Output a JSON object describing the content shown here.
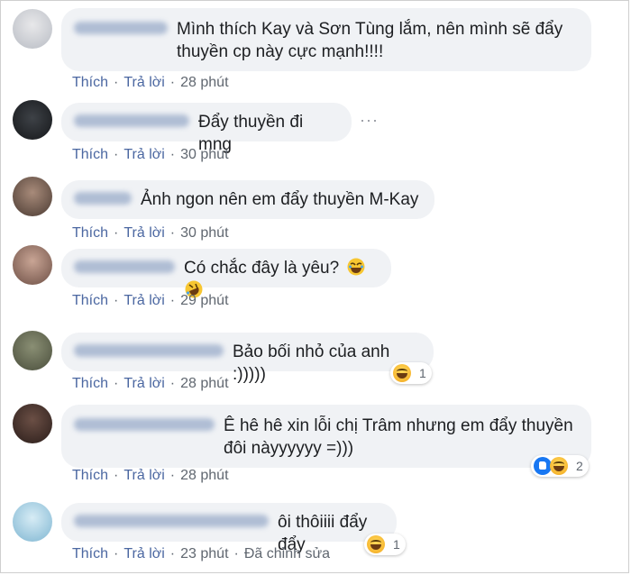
{
  "comments": [
    {
      "text": "Mình thích Kay và Sơn Tùng lắm, nên mình sẽ đẩy thuyền cp này cực mạnh!!!!",
      "actions": {
        "like": "Thích",
        "reply": "Trả lời",
        "time": "28 phút"
      }
    },
    {
      "text": "Đẩy thuyền đi mng",
      "more_icon": "···",
      "actions": {
        "like": "Thích",
        "reply": "Trả lời",
        "time": "30 phút"
      }
    },
    {
      "text": "Ảnh ngon nên em đẩy thuyền M-Kay",
      "actions": {
        "like": "Thích",
        "reply": "Trả lời",
        "time": "30 phút"
      }
    },
    {
      "text": "Có chắc đây là yêu?",
      "actions": {
        "like": "Thích",
        "reply": "Trả lời",
        "time": "29 phút"
      }
    },
    {
      "text": "Bảo bối nhỏ của anh :)))))",
      "reaction_count": "1",
      "actions": {
        "like": "Thích",
        "reply": "Trả lời",
        "time": "28 phút"
      }
    },
    {
      "text": "Ê hê hê xin lỗi chị Trâm nhưng em đẩy thuyền đôi nàyyyyyy =)))",
      "reaction_count": "2",
      "actions": {
        "like": "Thích",
        "reply": "Trả lời",
        "time": "28 phút"
      }
    },
    {
      "text": "ôi thôiiii đẩy đẩy",
      "reaction_count": "1",
      "actions": {
        "like": "Thích",
        "reply": "Trả lời",
        "time": "23 phút",
        "edited": "Đã chỉnh sửa"
      }
    }
  ],
  "colors": {
    "bubble": "#f0f2f5",
    "link": "#4b67a1",
    "meta": "#606770",
    "text": "#1c1e21"
  },
  "icons": [
    "laugh-emoji-icon",
    "like-emoji-icon",
    "more-options-icon"
  ]
}
